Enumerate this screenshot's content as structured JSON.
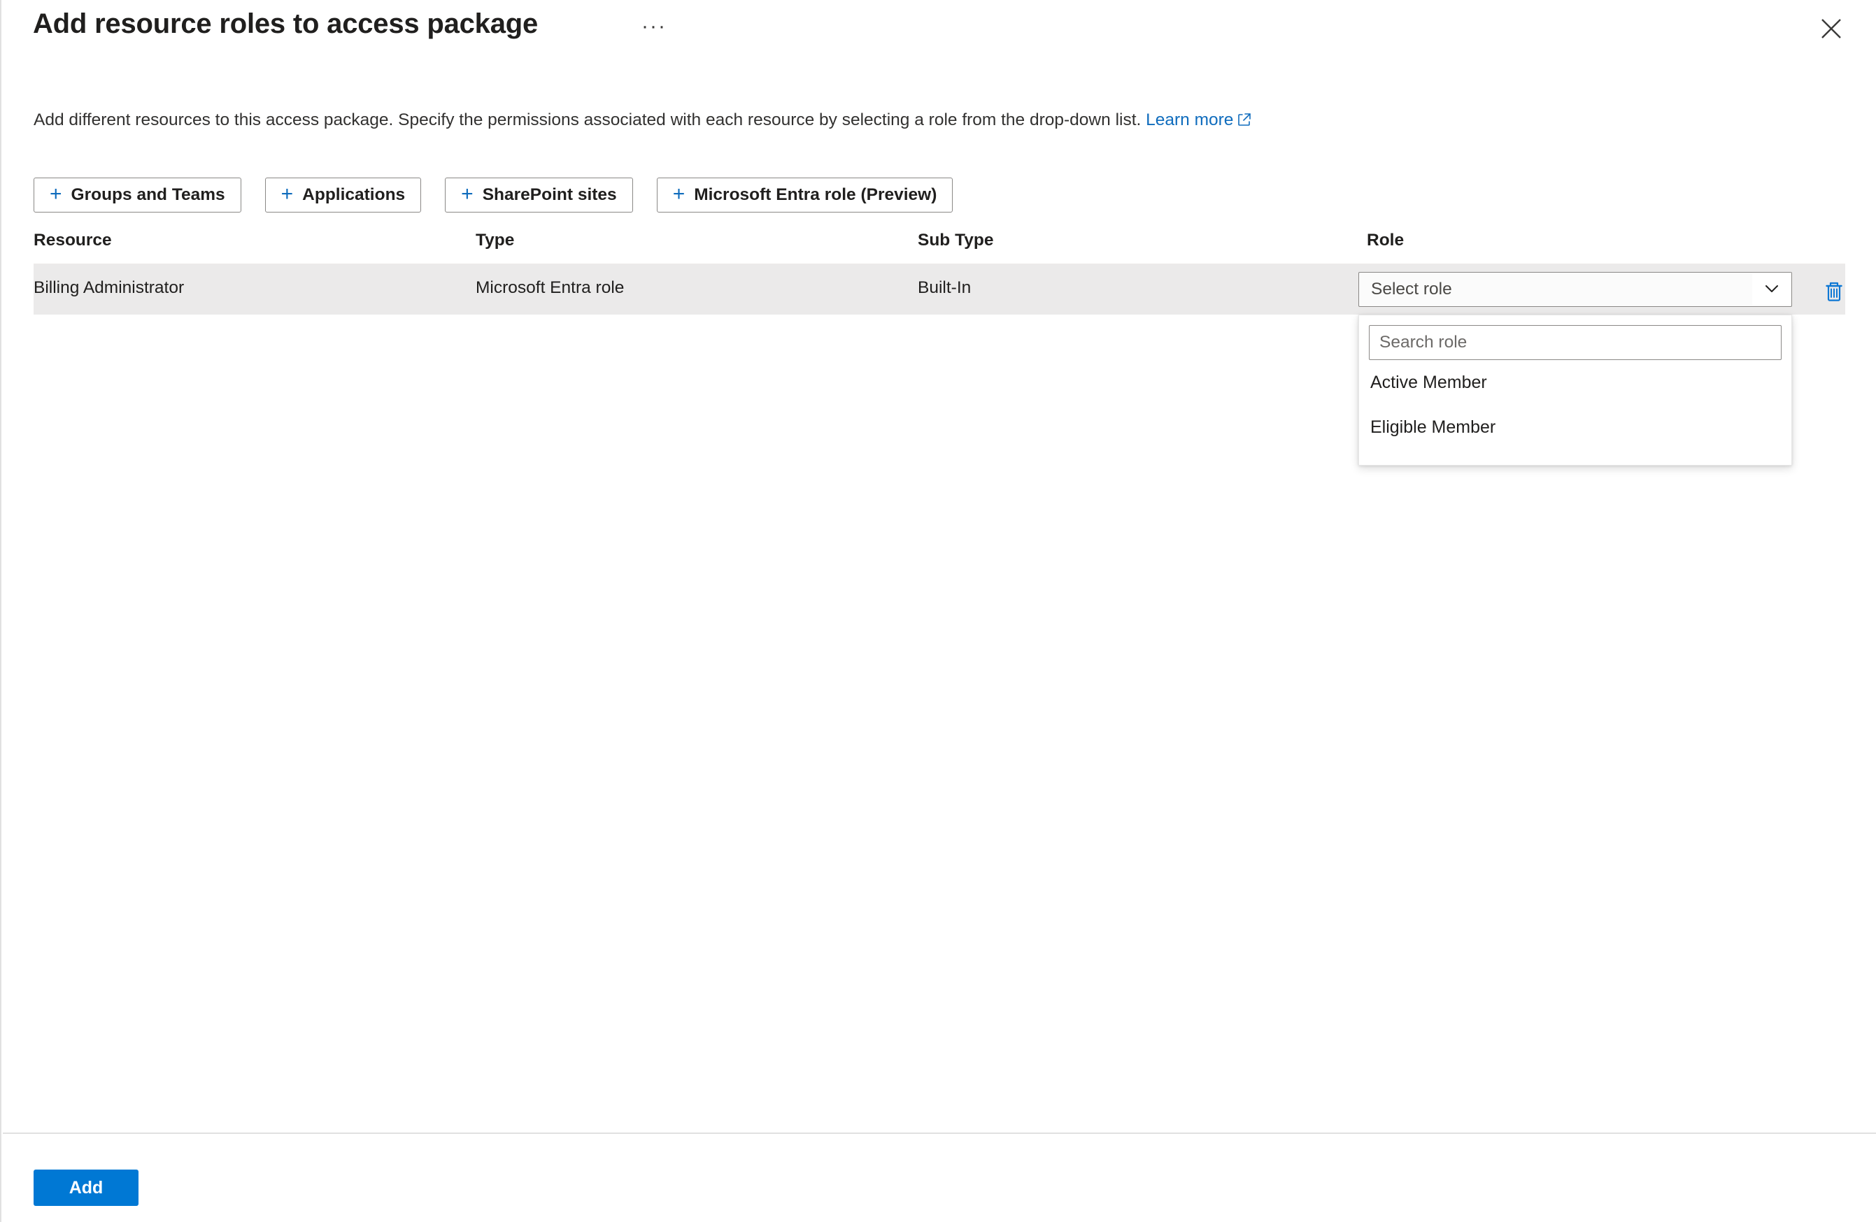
{
  "header": {
    "title": "Add resource roles to access package",
    "ellipsis_label": "···",
    "close_icon": "close-icon"
  },
  "description": {
    "text": "Add different resources to this access package. Specify the permissions associated with each resource by selecting a role from the drop-down list.",
    "link_label": "Learn more",
    "link_icon": "external-link-icon"
  },
  "toolbar": {
    "buttons": [
      {
        "label": "Groups and Teams",
        "icon": "plus-icon"
      },
      {
        "label": "Applications",
        "icon": "plus-icon"
      },
      {
        "label": "SharePoint sites",
        "icon": "plus-icon"
      },
      {
        "label": "Microsoft Entra role (Preview)",
        "icon": "plus-icon"
      }
    ]
  },
  "table": {
    "columns": [
      "Resource",
      "Type",
      "Sub Type",
      "Role"
    ],
    "rows": [
      {
        "resource": "Billing Administrator",
        "type": "Microsoft Entra role",
        "sub_type": "Built-In",
        "role_value": "Select role",
        "delete_icon": "trash-icon",
        "chevron_icon": "chevron-down-icon"
      }
    ]
  },
  "role_dropdown": {
    "open": true,
    "search_placeholder": "Search role",
    "search_value": "",
    "options": [
      "Active Member",
      "Eligible Member"
    ]
  },
  "footer": {
    "add_label": "Add"
  },
  "colors": {
    "accent": "#0078d4",
    "link": "#0f6cbd",
    "row_background": "#ebeaea",
    "border": "#8a8886"
  }
}
